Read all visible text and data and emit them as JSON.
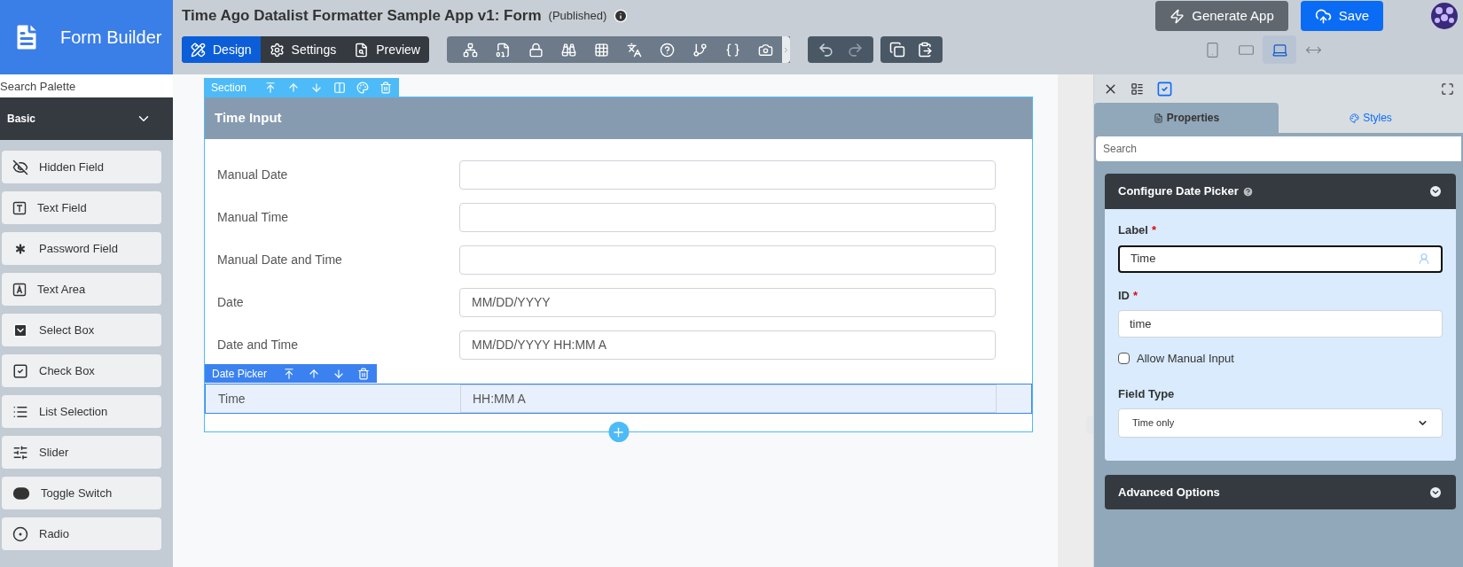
{
  "app": {
    "name": "Form Builder"
  },
  "form": {
    "title": "Time Ago Datalist Formatter Sample App v1: Form",
    "status": "(Published)"
  },
  "mode_tabs": [
    {
      "label": "Design",
      "selected": true
    },
    {
      "label": "Settings",
      "selected": false
    },
    {
      "label": "Preview",
      "selected": false
    }
  ],
  "header_buttons": [
    {
      "label": "Generate App",
      "kind": "secondary"
    },
    {
      "label": "Save",
      "kind": "primary"
    }
  ],
  "device_views": [
    {
      "selected": false
    },
    {
      "selected": false
    },
    {
      "selected": true
    },
    {
      "selected": false
    }
  ],
  "palette": {
    "placeholder": "Search Palette",
    "category": {
      "label": "Basic",
      "expanded": true
    },
    "items": [
      {
        "label": "Hidden Field"
      },
      {
        "label": "Text Field"
      },
      {
        "label": "Password Field"
      },
      {
        "label": "Text Area"
      },
      {
        "label": "Select Box"
      },
      {
        "label": "Check Box"
      },
      {
        "label": "List Selection"
      },
      {
        "label": "Slider"
      },
      {
        "label": "Toggle Switch"
      },
      {
        "label": "Radio"
      }
    ]
  },
  "section": {
    "toolbar_label": "Section",
    "title": "Time Input",
    "element_toolbar_label": "Date Picker",
    "fields": [
      {
        "label": "Manual Date",
        "selected": false
      },
      {
        "label": "Manual Time",
        "selected": false
      },
      {
        "label": "Manual Date and Time",
        "selected": false
      },
      {
        "label": "Date",
        "placeholder": "MM/DD/YYYY",
        "selected": false
      },
      {
        "label": "Date and Time",
        "placeholder": "MM/DD/YYYY HH:MM A",
        "selected": false
      },
      {
        "label": "Time",
        "placeholder": "HH:MM A",
        "selected": true
      }
    ]
  },
  "panel": {
    "tabs": [
      {
        "label": "Properties",
        "selected": true
      },
      {
        "label": "Styles",
        "selected": false
      }
    ],
    "search_placeholder": "Search",
    "config": {
      "title": "Configure Date Picker",
      "expanded": true,
      "label_field": {
        "label": "Label",
        "required_mark": "*",
        "value": "Time"
      },
      "id_field": {
        "label": "ID",
        "required_mark": "*",
        "value": "time"
      },
      "allow_manual": {
        "label": "Allow Manual Input",
        "checked": false
      },
      "field_type": {
        "label": "Field Type",
        "value": "Time only"
      }
    },
    "advanced": {
      "title": "Advanced Options",
      "expanded": false
    }
  }
}
